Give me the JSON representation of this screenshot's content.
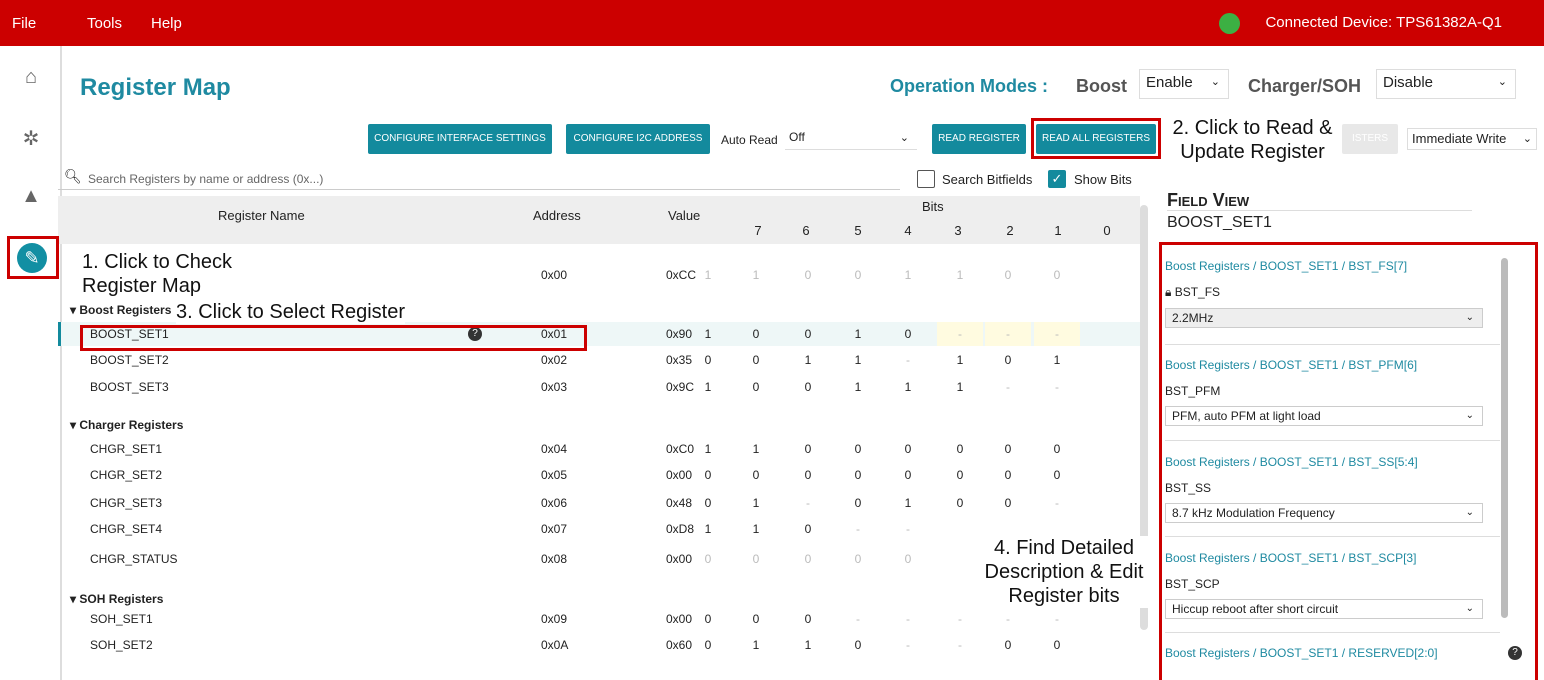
{
  "menubar": {
    "file": "File",
    "tools": "Tools",
    "help": "Help",
    "connected": "Connected Device: TPS61382A-Q1",
    "status_color": "#3cb043"
  },
  "header": {
    "title": "Register Map",
    "operation_modes": "Operation Modes :",
    "boost_label": "Boost",
    "boost_value": "Enable",
    "charger_label": "Charger/SOH",
    "charger_value": "Disable"
  },
  "toolbar": {
    "configure_interface": "CONFIGURE INTERFACE SETTINGS",
    "configure_i2c": "CONFIGURE I2C ADDRESS",
    "auto_read_label": "Auto Read",
    "auto_read_value": "Off",
    "read_register": "READ REGISTER",
    "read_all": "READ ALL REGISTERS",
    "hidden_button": "ISTERS",
    "write_mode": "Immediate Write"
  },
  "search": {
    "placeholder": "Search Registers by name or address (0x...)",
    "search_bitfields": "Search Bitfields",
    "show_bits": "Show Bits"
  },
  "table": {
    "headers": {
      "name": "Register Name",
      "address": "Address",
      "value": "Value",
      "bits": "Bits"
    },
    "bit_labels": [
      "7",
      "6",
      "5",
      "4",
      "3",
      "2",
      "1",
      "0"
    ],
    "rows": [
      {
        "name": "",
        "address": "0x00",
        "value": "0xCC",
        "bits": [
          "1",
          "1",
          "0",
          "0",
          "1",
          "1",
          "0",
          "0"
        ],
        "dim": true
      },
      {
        "group": "Boost Registers"
      },
      {
        "name": "BOOST_SET1",
        "address": "0x01",
        "value": "0x90",
        "bits": [
          "1",
          "0",
          "0",
          "1",
          "0",
          "-",
          "-",
          "-"
        ],
        "selected": true
      },
      {
        "name": "BOOST_SET2",
        "address": "0x02",
        "value": "0x35",
        "bits": [
          "0",
          "0",
          "1",
          "1",
          "-",
          "1",
          "0",
          "1"
        ]
      },
      {
        "name": "BOOST_SET3",
        "address": "0x03",
        "value": "0x9C",
        "bits": [
          "1",
          "0",
          "0",
          "1",
          "1",
          "1",
          "-",
          "-"
        ]
      },
      {
        "group": "Charger Registers"
      },
      {
        "name": "CHGR_SET1",
        "address": "0x04",
        "value": "0xC0",
        "bits": [
          "1",
          "1",
          "0",
          "0",
          "0",
          "0",
          "0",
          "0"
        ]
      },
      {
        "name": "CHGR_SET2",
        "address": "0x05",
        "value": "0x00",
        "bits": [
          "0",
          "0",
          "0",
          "0",
          "0",
          "0",
          "0",
          "0"
        ]
      },
      {
        "name": "CHGR_SET3",
        "address": "0x06",
        "value": "0x48",
        "bits": [
          "0",
          "1",
          "-",
          "0",
          "1",
          "0",
          "0",
          "-"
        ]
      },
      {
        "name": "CHGR_SET4",
        "address": "0x07",
        "value": "0xD8",
        "bits": [
          "1",
          "1",
          "0",
          "-",
          "-",
          "",
          "",
          ""
        ]
      },
      {
        "name": "CHGR_STATUS",
        "address": "0x08",
        "value": "0x00",
        "bits": [
          "0",
          "0",
          "0",
          "0",
          "0",
          "",
          "",
          ""
        ],
        "dim": true
      },
      {
        "group": "SOH Registers"
      },
      {
        "name": "SOH_SET1",
        "address": "0x09",
        "value": "0x00",
        "bits": [
          "0",
          "0",
          "0",
          "-",
          "-",
          "-",
          "-",
          "-"
        ]
      },
      {
        "name": "SOH_SET2",
        "address": "0x0A",
        "value": "0x60",
        "bits": [
          "0",
          "1",
          "1",
          "0",
          "-",
          "-",
          "0",
          "0"
        ]
      }
    ]
  },
  "field_view": {
    "title": "Field View",
    "register": "BOOST_SET1",
    "fields": [
      {
        "path": "Boost Registers / BOOST_SET1 / BST_FS[7]",
        "name": "BST_FS",
        "value": "2.2MHz",
        "locked": true
      },
      {
        "path": "Boost Registers / BOOST_SET1 / BST_PFM[6]",
        "name": "BST_PFM",
        "value": "PFM, auto PFM at light load"
      },
      {
        "path": "Boost Registers / BOOST_SET1 / BST_SS[5:4]",
        "name": "BST_SS",
        "value": "8.7 kHz Modulation Frequency"
      },
      {
        "path": "Boost Registers / BOOST_SET1 / BST_SCP[3]",
        "name": "BST_SCP",
        "value": "Hiccup reboot after short circuit"
      },
      {
        "path": "Boost Registers / BOOST_SET1 / RESERVED[2:0]",
        "name": "",
        "value": ""
      }
    ]
  },
  "annotations": {
    "a1": "1. Click to Check Register Map",
    "a2": "2. Click to Read & Update Register",
    "a3": "3. Click to Select Register",
    "a4": "4. Find Detailed Description & Edit Register bits"
  }
}
